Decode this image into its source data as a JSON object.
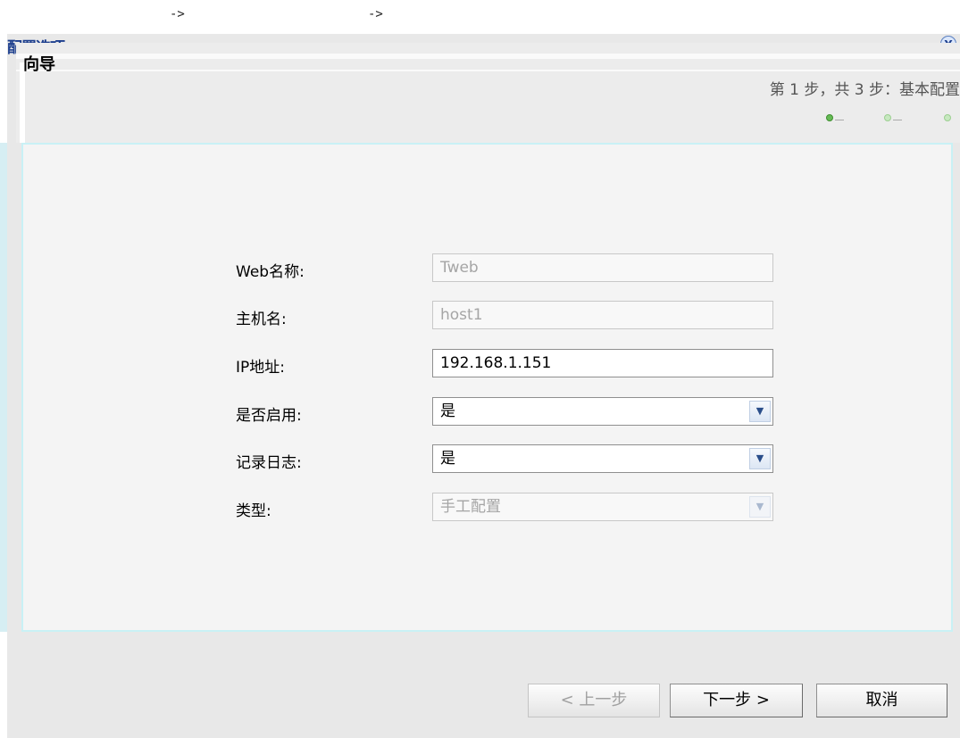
{
  "breadcrumb": [
    "->",
    "->"
  ],
  "window": {
    "title": "配置选项",
    "title_icon": "filter-icon"
  },
  "wizard": {
    "title": "向导",
    "step_text": "第 1 步，共 3 步：基本配置",
    "current_step": 1,
    "total_steps": 3
  },
  "form": {
    "web_name": {
      "label": "Web名称:",
      "value": "Tweb",
      "disabled": true
    },
    "host_name": {
      "label": "主机名:",
      "value": "host1",
      "disabled": true
    },
    "ip_address": {
      "label": "IP地址:",
      "value": "192.168.1.151",
      "disabled": false
    },
    "enabled": {
      "label": "是否启用:",
      "value": "是",
      "disabled": false
    },
    "log": {
      "label": "记录日志:",
      "value": "是",
      "disabled": false
    },
    "type": {
      "label": "类型:",
      "value": "手工配置",
      "disabled": true
    }
  },
  "buttons": {
    "prev": "< 上一步",
    "next": "下一步 >",
    "cancel": "取消"
  },
  "colors": {
    "title": "#1d3f8e",
    "content_border": "#c9f1f5",
    "active_step": "#66bb55"
  }
}
